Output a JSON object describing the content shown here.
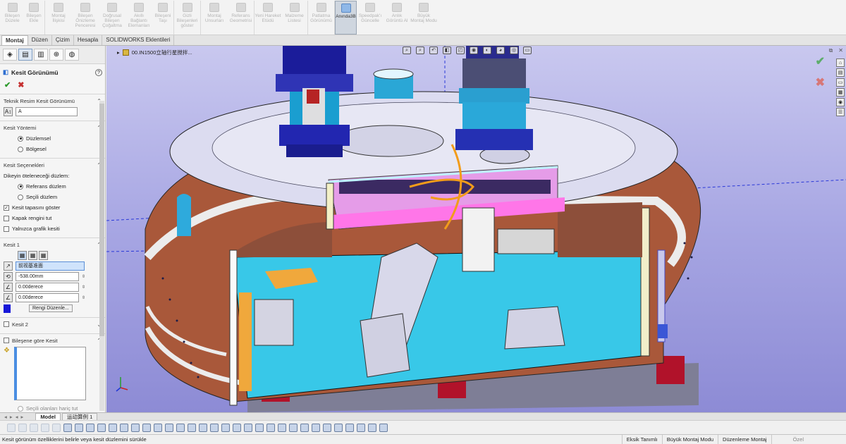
{
  "ribbon": {
    "buttons": [
      {
        "label": "Bileşen Düzele",
        "icon": "edit-component-icon"
      },
      {
        "label": "Bileşen Ekle",
        "icon": "insert-component-icon"
      },
      {
        "label": "Montaj İlişkisi",
        "icon": "mate-icon"
      },
      {
        "label": "Bileşen Önizleme Penceresi",
        "icon": "preview-window-icon"
      },
      {
        "label": "Doğrusal Bileşen Çoğaltma",
        "icon": "linear-pattern-icon"
      },
      {
        "label": "Akıllı Bağlantı Elemanları",
        "icon": "smart-fasteners-icon"
      },
      {
        "label": "Bileşeni Taşı",
        "icon": "move-component-icon"
      },
      {
        "label": "Gizli Bileşenleri göster",
        "icon": "show-hidden-icon"
      },
      {
        "label": "Montaj Unsurları",
        "icon": "assembly-features-icon"
      },
      {
        "label": "Referans Geometrisi",
        "icon": "reference-geometry-icon"
      },
      {
        "label": "Yeni Hareket Etüdü",
        "icon": "motion-study-icon"
      },
      {
        "label": "Malzeme Listesi",
        "icon": "bom-icon"
      },
      {
        "label": "Patlatma Görünümü",
        "icon": "exploded-view-icon"
      },
      {
        "label": "Anında3B",
        "icon": "instant3d-icon",
        "active": true
      },
      {
        "label": "Speedpak'ı Güncelle",
        "icon": "speedpak-icon"
      },
      {
        "label": "Anlık Görüntü Al",
        "icon": "snapshot-icon"
      },
      {
        "label": "Büyük Montaj Modu",
        "icon": "large-assembly-icon"
      }
    ]
  },
  "cm_tabs": [
    "Montaj",
    "Düzen",
    "Çizim",
    "Hesapla",
    "SOLIDWORKS Eklentileri"
  ],
  "pm": {
    "title": "Kesit Görünümü",
    "help": "?",
    "ok": "✔",
    "cancel": "✖",
    "g1_title": "Teknik Resim Kesit Görünümü",
    "g1_value": "A",
    "g2_title": "Kesit Yöntemi",
    "g2_opt1": "Düzlemsel",
    "g2_opt2": "Bölgesel",
    "g3_title": "Kesit Seçenekleri",
    "g3_prompt": "Dikeyin öteleneceği düzlem:",
    "g3_opt1": "Referans düzlem",
    "g3_opt2": "Seçili düzlem",
    "g3_chk1": "Kesit tapasını göster",
    "g3_chk2": "Kapak rengini tut",
    "g3_chk3": "Yalnızca grafik kesiti",
    "g4_title": "Kesit 1",
    "g4_plane": "前视基准面",
    "g4_offset": "-538.00mm",
    "g4_angle1": "0.00derece",
    "g4_angle2": "0.00derece",
    "g4_btn": "Rengi Düzenle...",
    "g5_title": "Kesit 2",
    "g6_title": "Bileşene göre Kesit",
    "g6_footer": "Seçili olanları hariç tut"
  },
  "viewport": {
    "doc_title": "00.IN1500立轴行星搅拌...",
    "chevron": "▸",
    "confirm_ok": "✔",
    "confirm_cancel": "✖"
  },
  "model_tabs": {
    "arrows": "◂ ▸ ◂ ▸",
    "items": [
      "Model",
      "运动算例 1"
    ]
  },
  "status": {
    "message": "Kesit görünüm özelliklerini belirle veya kesit düzlemini sürükle",
    "cells": [
      "Eksik Tanımlı",
      "Büyük Montaj Modu",
      "Düzenleme Montaj",
      "Özel"
    ]
  },
  "colors": {
    "background_top": "#c9c8ef",
    "background_bottom": "#8d8bd5",
    "accent": "#2f6fd1"
  }
}
